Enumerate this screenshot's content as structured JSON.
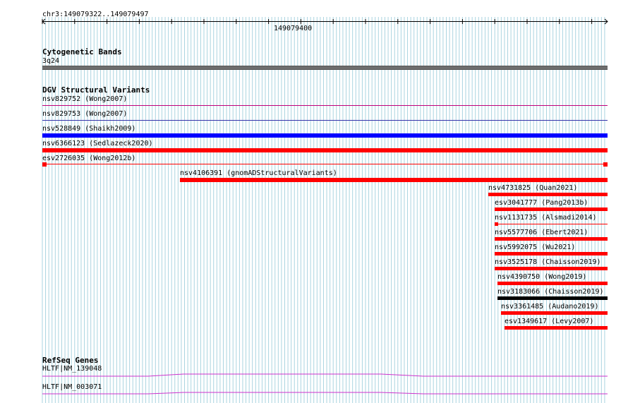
{
  "ruler": {
    "location": "chr3:149079322..149079497",
    "center_label": "149079400"
  },
  "tracks": {
    "cytoband": {
      "title": "Cytogenetic Bands",
      "band": "3q24",
      "color": "#6e6e6e"
    },
    "dgv": {
      "title": "DGV Structural Variants",
      "colors": {
        "loss": "#ff0000",
        "gain": "#0000ff",
        "complex": "#000000",
        "thin": "#c0007a"
      },
      "features": [
        {
          "label": "nsv829752 (Wong2007)",
          "style": "thin"
        },
        {
          "label": "nsv829753 (Wong2007)",
          "style": "thin-blue"
        },
        {
          "label": "nsv528849 (Shaikh2009)",
          "style": "gain"
        },
        {
          "label": "nsv6366123 (Sedlazeck2020)",
          "style": "loss"
        },
        {
          "label": "esv2726035 (Wong2012b)",
          "style": "split"
        },
        {
          "label": "nsv4106391 (gnomADStructuralVariants)",
          "style": "loss"
        },
        {
          "label": "nsv4731825 (Quan2021)",
          "style": "loss"
        },
        {
          "label": "esv3041777 (Pang2013b)",
          "style": "loss"
        },
        {
          "label": "nsv1131735 (Alsmadi2014)",
          "style": "thin-start"
        },
        {
          "label": "nsv5577706 (Ebert2021)",
          "style": "loss"
        },
        {
          "label": "nsv5992075 (Wu2021)",
          "style": "loss"
        },
        {
          "label": "nsv3525178 (Chaisson2019)",
          "style": "loss"
        },
        {
          "label": "nsv4390750 (Wong2019)",
          "style": "loss"
        },
        {
          "label": "nsv3183066 (Chaisson2019)",
          "style": "complex"
        },
        {
          "label": "nsv3361485 (Audano2019)",
          "style": "loss"
        },
        {
          "label": "esv1349617 (Levy2007)",
          "style": "loss"
        }
      ]
    },
    "refseq": {
      "title": "RefSeq Genes",
      "color": "#cc33cc",
      "genes": [
        {
          "label": "HLTF|NM_139048"
        },
        {
          "label": "HLTF|NM_003071"
        }
      ]
    }
  }
}
